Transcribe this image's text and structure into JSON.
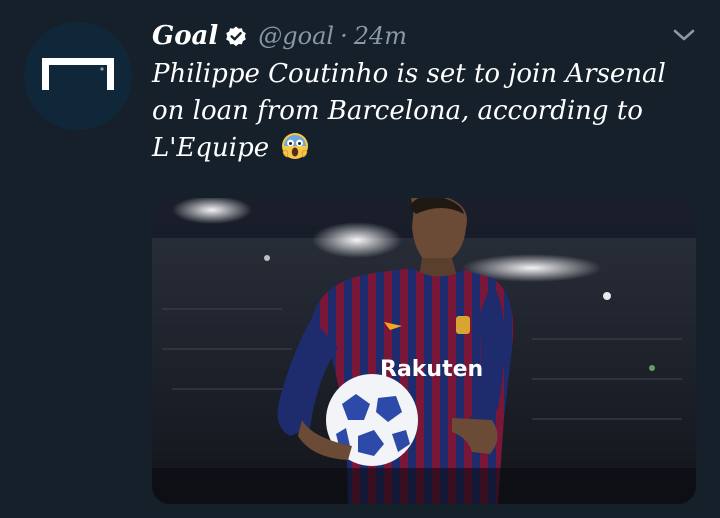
{
  "tweet": {
    "display_name": "Goal",
    "handle": "@goal",
    "separator": "·",
    "time": "24m",
    "text": "Philippe Coutinho is set to join Arsenal on loan from Barcelona, according to L'Equipe",
    "emoji": "😱",
    "media": {
      "sponsor_text": "Rakuten"
    }
  },
  "icons": {
    "verified": "verified-badge-icon",
    "menu": "chevron-down-icon",
    "avatar": "goal-logo"
  },
  "colors": {
    "background": "#15202b",
    "text": "#ffffff",
    "secondary": "#8899a6",
    "avatar_bg": "#10273a"
  }
}
